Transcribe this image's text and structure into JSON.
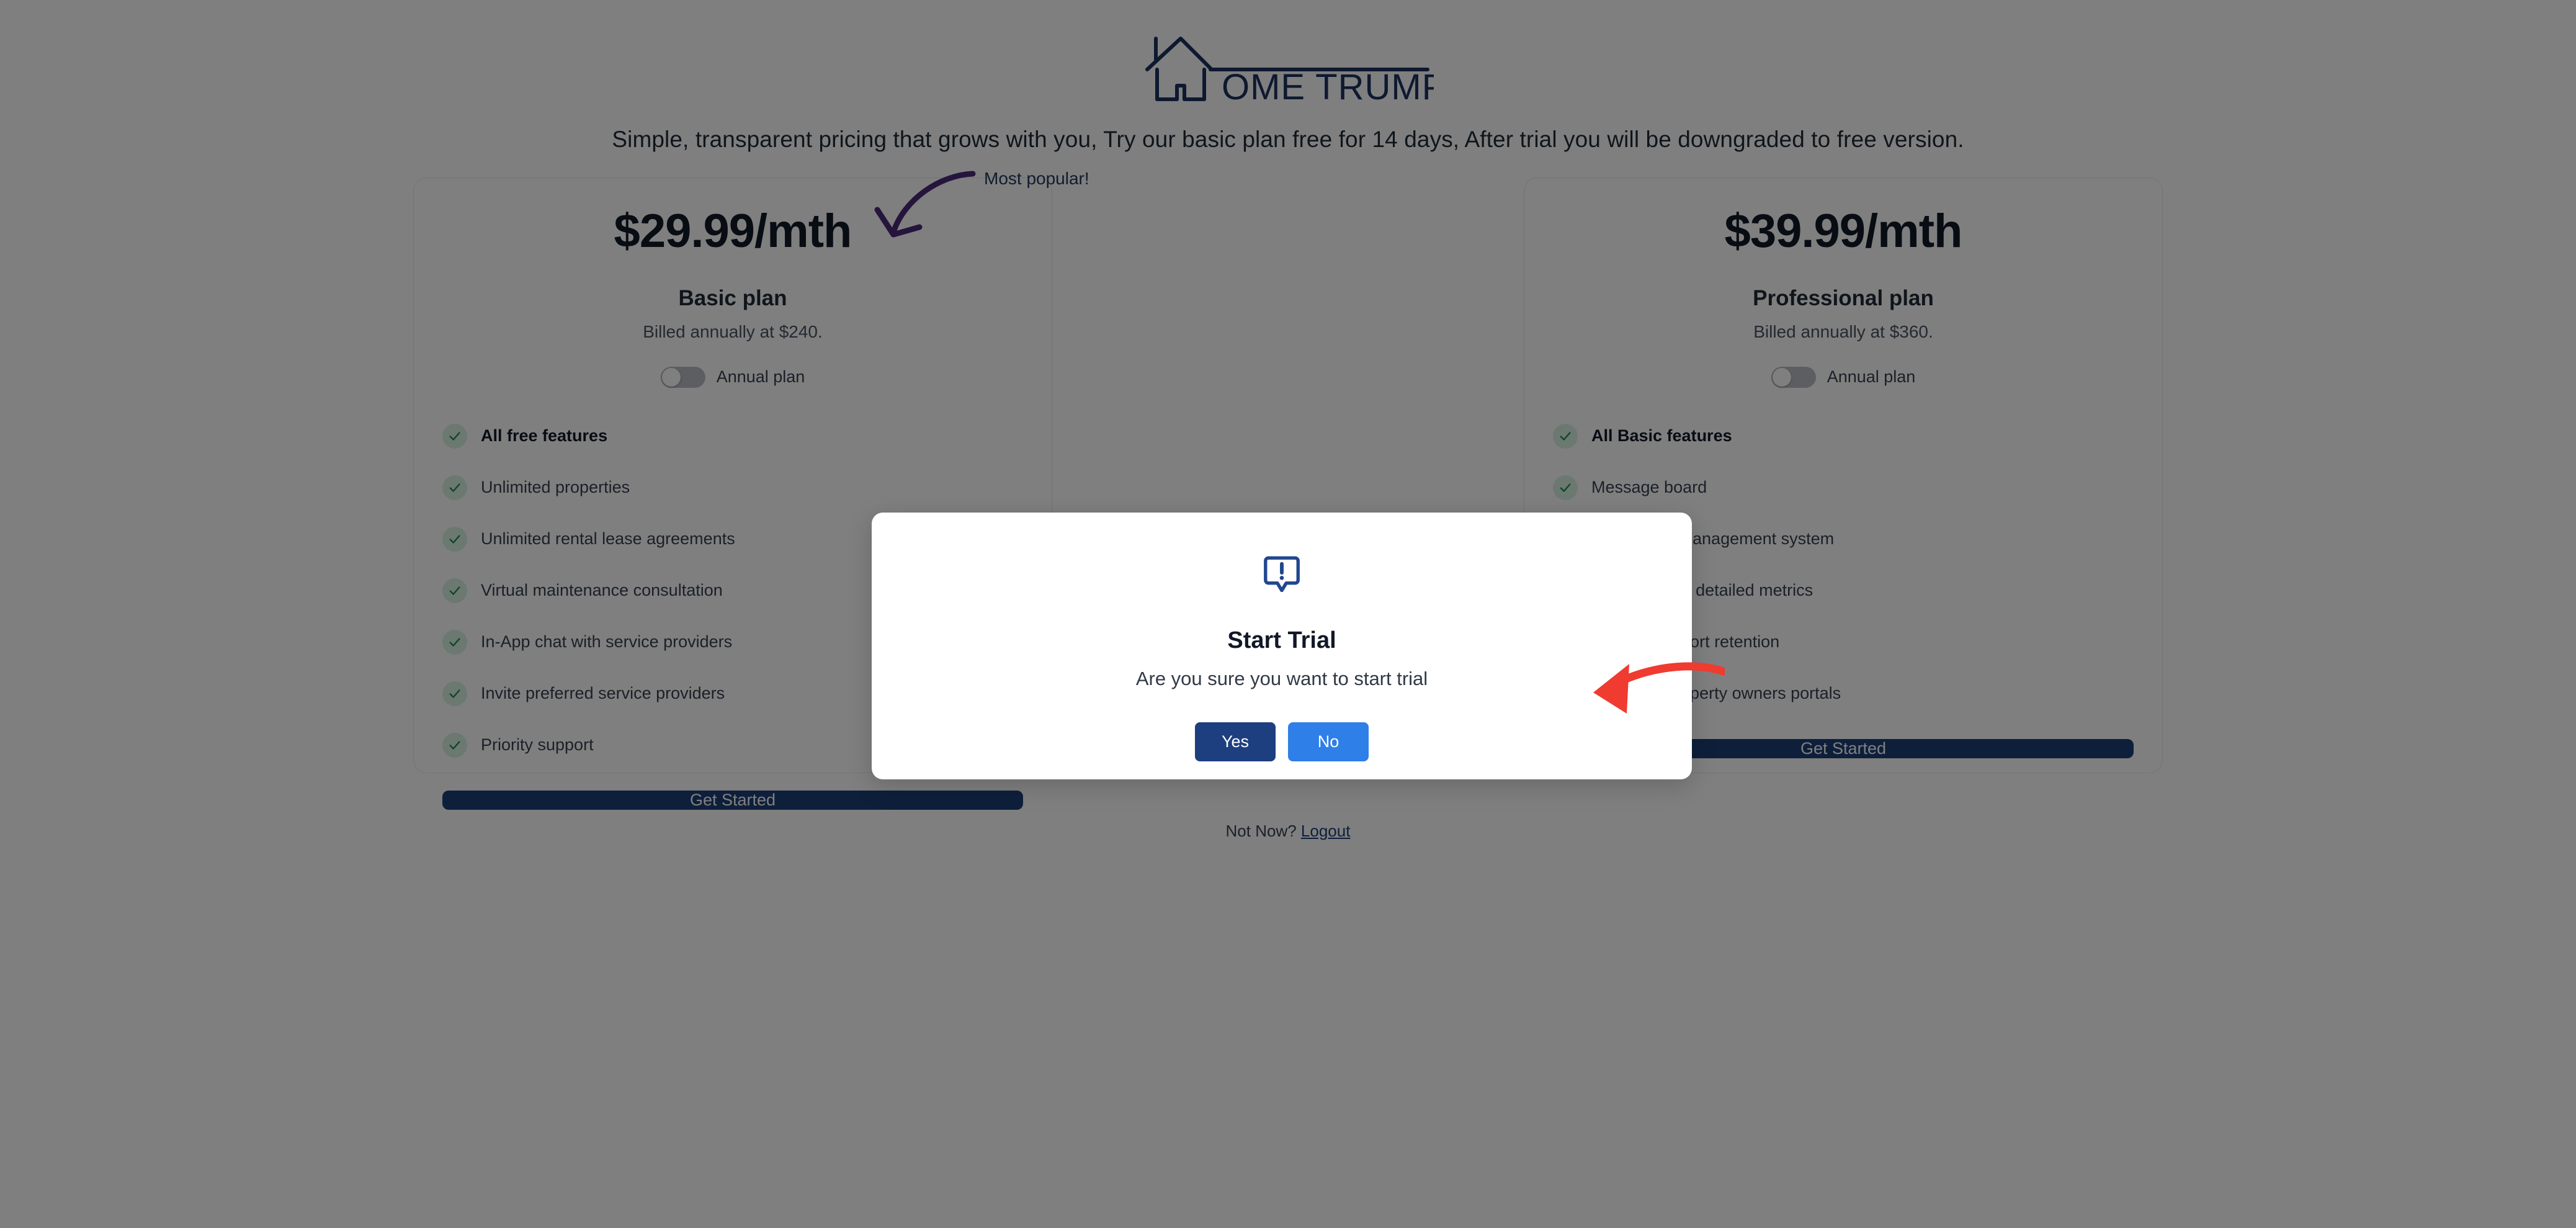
{
  "brand": {
    "name": "HOME TRUMPETER",
    "wordmark": "OME TRUMPETER",
    "color": "#1b3260"
  },
  "tagline": "Simple, transparent pricing that grows with you, Try our basic plan free for 14 days, After trial you will be downgraded to free version.",
  "annotations": {
    "most_popular": {
      "label": "Most popular!",
      "color": "#4b2a7b"
    },
    "red_arrow": {
      "color": "#ef3b30"
    }
  },
  "plans": [
    {
      "price": "$29.99/mth",
      "name": "Basic plan",
      "billed": "Billed annually at $240.",
      "toggle_label": "Annual plan",
      "toggle_on": false,
      "cta": "Get Started",
      "features": [
        {
          "text": "All free features",
          "bold": true
        },
        {
          "text": "Unlimited properties",
          "bold": false
        },
        {
          "text": "Unlimited rental lease agreements",
          "bold": false
        },
        {
          "text": "Virtual maintenance consultation",
          "bold": false
        },
        {
          "text": "In-App chat with service providers",
          "bold": false
        },
        {
          "text": "Invite preferred service providers",
          "bold": false
        },
        {
          "text": "Priority support",
          "bold": false
        }
      ]
    },
    {
      "price": "$39.99/mth",
      "name": "Professional plan",
      "billed": "Billed annually at $360.",
      "toggle_label": "Annual plan",
      "toggle_on": false,
      "cta": "Get Started",
      "features": [
        {
          "text": "All Basic features",
          "bold": true
        },
        {
          "text": "Message board",
          "bold": false
        },
        {
          "text": "Work order management system",
          "bold": false
        },
        {
          "text": "Analytics and detailed metrics",
          "bold": false
        },
        {
          "text": "Unlimited report retention",
          "bold": false
        },
        {
          "text": "Unlimited property owners portals",
          "bold": false
        }
      ]
    }
  ],
  "footer": {
    "prefix": "Not Now?",
    "link": "Logout"
  },
  "modal": {
    "icon": "exclamation-bubble-icon",
    "title": "Start Trial",
    "message": "Are you sure you want to start trial",
    "confirm_label": "Yes",
    "cancel_label": "No",
    "confirm_color": "#1e3f7f",
    "cancel_color": "#2f7fe8"
  }
}
